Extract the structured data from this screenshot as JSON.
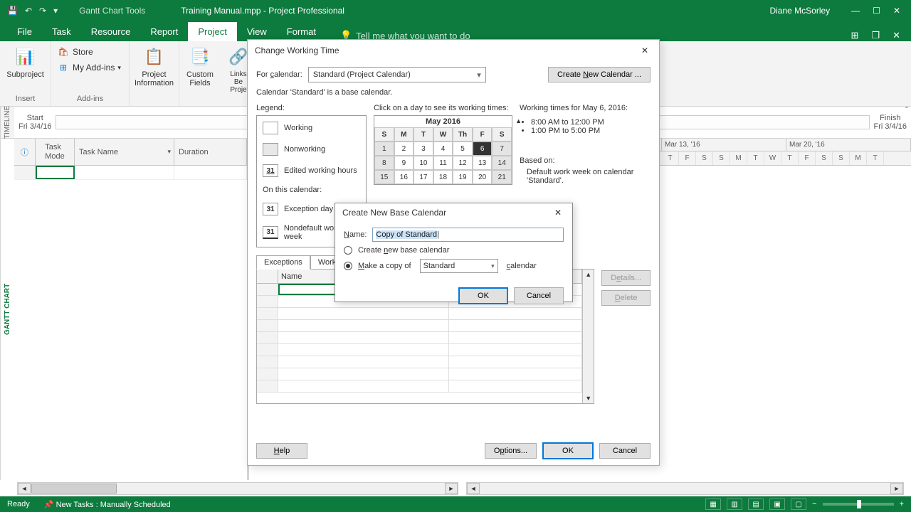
{
  "titlebar": {
    "tools": "Gantt Chart Tools",
    "filename": "Training Manual.mpp - Project Professional",
    "user": "Diane McSorley"
  },
  "menu": {
    "file": "File",
    "task": "Task",
    "resource": "Resource",
    "report": "Report",
    "project": "Project",
    "view": "View",
    "format": "Format",
    "tellme": "Tell me what you want to do"
  },
  "ribbon": {
    "subproject": "Subproject",
    "store": "Store",
    "myaddins": "My Add-ins",
    "projinfo": "Project\nInformation",
    "custfields": "Custom\nFields",
    "linksproj": "Links Between\nProjects",
    "grp_insert": "Insert",
    "grp_addins": "Add-ins"
  },
  "timeline": {
    "start_label": "Start",
    "start_date": "Fri 3/4/16",
    "finish_label": "Finish",
    "finish_date": "Fri 3/4/16",
    "side": "TIMELINE"
  },
  "grid": {
    "side": "GANTT CHART",
    "col_mode": "Task\nMode",
    "col_name": "Task Name",
    "col_dur": "Duration"
  },
  "chart": {
    "weeks": [
      "Mar 13, '16",
      "Mar 20, '16"
    ],
    "days": [
      "T",
      "F",
      "S",
      "S",
      "M",
      "T",
      "W",
      "T",
      "F",
      "S",
      "S",
      "M",
      "T"
    ]
  },
  "dlg1": {
    "title": "Change Working Time",
    "for_cal": "For calendar:",
    "for_cal_val": "Standard (Project Calendar)",
    "create_btn": "Create New Calendar ...",
    "base_msg": "Calendar 'Standard' is a base calendar.",
    "legend": "Legend:",
    "lg_working": "Working",
    "lg_nonwork": "Nonworking",
    "lg_edited": "Edited working hours",
    "on_this": "On this calendar:",
    "lg_exc": "Exception day",
    "lg_nondef": "Nondefault work week",
    "click_msg": "Click on a day to see its working times:",
    "cal_title": "May 2016",
    "dayheads": [
      "S",
      "M",
      "T",
      "W",
      "Th",
      "F",
      "S"
    ],
    "days_w1": [
      "1",
      "2",
      "3",
      "4",
      "5",
      "6",
      "7"
    ],
    "days_w2": [
      "8",
      "9",
      "10",
      "11",
      "12",
      "13",
      "14"
    ],
    "days_w3": [
      "15",
      "16",
      "17",
      "18",
      "19",
      "20",
      "21"
    ],
    "wt_title": "Working times for May 6, 2016:",
    "wt1": "8:00 AM to 12:00 PM",
    "wt2": "1:00 PM to 5:00 PM",
    "based": "Based on:",
    "based_txt": "Default work week on calendar 'Standard'.",
    "tab_exc": "Exceptions",
    "tab_ww": "Work Weeks",
    "col_name": "Name",
    "details": "Details...",
    "delete": "Delete",
    "help": "Help",
    "options": "Options...",
    "ok": "OK",
    "cancel": "Cancel"
  },
  "dlg2": {
    "title": "Create New Base Calendar",
    "name_lbl": "Name:",
    "name_val": "Copy of Standard",
    "opt1": "Create new base calendar",
    "opt2": "Make a copy of",
    "copy_val": "Standard",
    "cal_word": "calendar",
    "ok": "OK",
    "cancel": "Cancel"
  },
  "status": {
    "ready": "Ready",
    "newtasks": "New Tasks : Manually Scheduled"
  }
}
